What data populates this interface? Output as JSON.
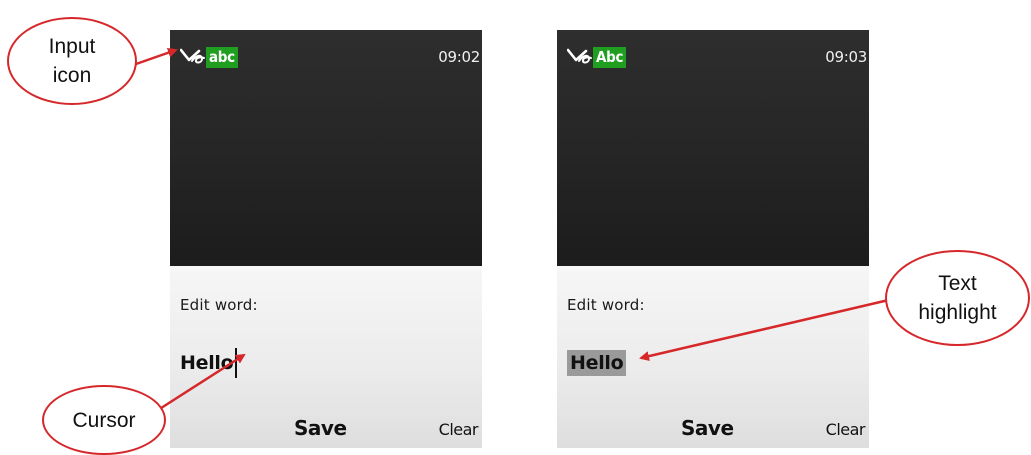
{
  "screens": [
    {
      "status": {
        "input_mode": "abc",
        "time": "09:02"
      },
      "editor": {
        "label": "Edit word:",
        "word": "Hello",
        "cursor_visible": true,
        "word_highlighted": false
      },
      "softkeys": {
        "center": "Save",
        "right": "Clear"
      }
    },
    {
      "status": {
        "input_mode": "Abc",
        "time": "09:03"
      },
      "editor": {
        "label": "Edit word:",
        "word": "Hello",
        "cursor_visible": false,
        "word_highlighted": true
      },
      "softkeys": {
        "center": "Save",
        "right": "Clear"
      }
    }
  ],
  "callouts": {
    "input_icon": {
      "line1": "Input",
      "line2": "icon"
    },
    "cursor": {
      "text": "Cursor"
    },
    "text_highlight": {
      "line1": "Text",
      "line2": "highlight"
    }
  },
  "colors": {
    "screen_background": "#262626",
    "input_mode_badge": "#1f9e1f",
    "editor_background": "#ececec",
    "highlight": "#9a9a9a",
    "callout_red": "#d6282b"
  },
  "icons": {
    "input": "pen-stroke-icon"
  }
}
